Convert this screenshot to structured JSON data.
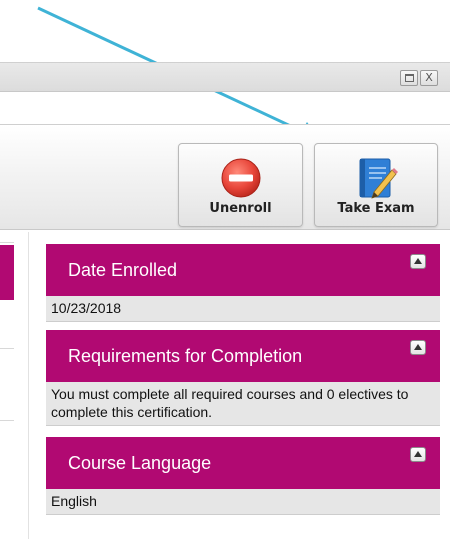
{
  "window": {
    "restore_icon": "restore-icon",
    "close_glyph": "X"
  },
  "toolbar": {
    "unenroll": {
      "label": "Unenroll",
      "icon": "no-entry-icon",
      "icon_color": "#e8463a"
    },
    "take_exam": {
      "label": "Take Exam",
      "icon": "notebook-pencil-icon",
      "icon_color": "#2f7fd6"
    }
  },
  "annotation": {
    "arrow_color": "#3fb3d6"
  },
  "panels": [
    {
      "title": "Date Enrolled",
      "body": "10/23/2018"
    },
    {
      "title": "Requirements for Completion",
      "body": "You must complete all required courses and 0 electives to complete this certification."
    },
    {
      "title": "Course Language",
      "body": "English"
    }
  ],
  "colors": {
    "panel_header": "#b10972",
    "panel_body": "#e6e6e6"
  }
}
